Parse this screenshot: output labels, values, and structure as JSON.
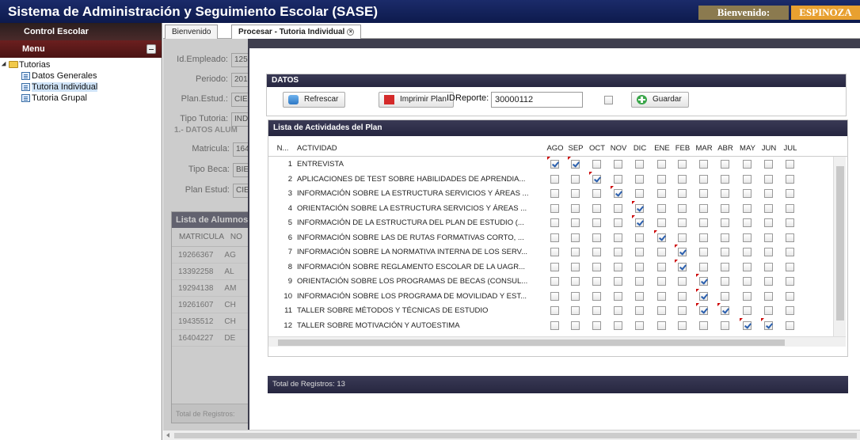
{
  "app": {
    "title": "Sistema de Administración y Seguimiento Escolar (SASE)",
    "welcome": "Bienvenido:",
    "username": "ESPINOZA"
  },
  "sidebar": {
    "header": "Control Escolar",
    "menu_label": "Menu",
    "tree": {
      "root": "Tutorias",
      "items": [
        "Datos Generales",
        "Tutoria Individual",
        "Tutoria Grupal"
      ],
      "selected": "Tutoria Individual"
    }
  },
  "tabs": [
    {
      "label": "Bienvenido",
      "active": false
    },
    {
      "label": "Procesar - Tutoria Individual",
      "active": true
    }
  ],
  "form": {
    "fields": [
      {
        "label": "Id.Empleado:",
        "value": "125"
      },
      {
        "label": "Periodo:",
        "value": "201"
      },
      {
        "label": "Plan.Estud.:",
        "value": "CIE"
      },
      {
        "label": "Tipo Tutoria:",
        "value": "IND"
      }
    ],
    "section_title": "1.- DATOS ALUM",
    "student_fields": [
      {
        "label": "Matricula:",
        "value": "164"
      },
      {
        "label": "Tipo Beca:",
        "value": "BIE"
      },
      {
        "label": "Plan Estud:",
        "value": "CIE"
      }
    ]
  },
  "alumnos": {
    "title": "Lista de Alumnos",
    "columns": [
      "MATRICULA",
      "NO"
    ],
    "rows": [
      {
        "matricula": "19266367",
        "nombre": "AG"
      },
      {
        "matricula": "13392258",
        "nombre": "AL"
      },
      {
        "matricula": "19294138",
        "nombre": "AM"
      },
      {
        "matricula": "19261607",
        "nombre": "CH"
      },
      {
        "matricula": "19435512",
        "nombre": "CH"
      },
      {
        "matricula": "16404227",
        "nombre": "DE"
      }
    ],
    "footer": "Total de Registros:"
  },
  "datos": {
    "title": "DATOS",
    "refresh_label": "Refrescar",
    "print_label": "Imprimir Plan",
    "idreporte_label": "IDReporte:",
    "idreporte_value": "30000112",
    "save_label": "Guardar"
  },
  "actividades": {
    "title": "Lista de Actividades del Plan",
    "columns": {
      "num": "N...",
      "activity": "ACTIVIDAD",
      "months": [
        "AGO",
        "SEP",
        "OCT",
        "NOV",
        "DIC",
        "ENE",
        "FEB",
        "MAR",
        "ABR",
        "MAY",
        "JUN",
        "JUL"
      ]
    },
    "rows": [
      {
        "n": "1",
        "activity": "ENTREVISTA",
        "checked": [
          0,
          1
        ]
      },
      {
        "n": "2",
        "activity": "APLICACIONES DE TEST SOBRE HABILIDADES DE APRENDIA...",
        "checked": [
          2
        ]
      },
      {
        "n": "3",
        "activity": "INFORMACIÓN SOBRE LA ESTRUCTURA SERVICIOS Y ÁREAS ...",
        "checked": [
          3
        ]
      },
      {
        "n": "4",
        "activity": "ORIENTACIÓN SOBRE LA ESTRUCTURA SERVICIOS Y ÁREAS ...",
        "checked": [
          4
        ]
      },
      {
        "n": "5",
        "activity": "INFORMACIÓN DE LA ESTRUCTURA DEL PLAN DE ESTUDIO (...",
        "checked": [
          4
        ]
      },
      {
        "n": "6",
        "activity": "INFORMACIÓN SOBRE LAS DE RUTAS FORMATIVAS CORTO, ...",
        "checked": [
          5
        ]
      },
      {
        "n": "7",
        "activity": "INFORMACIÓN SOBRE LA NORMATIVA INTERNA DE LOS SERV...",
        "checked": [
          6
        ]
      },
      {
        "n": "8",
        "activity": "INFORMACIÓN SOBRE REGLAMENTO ESCOLAR DE LA UAGR...",
        "checked": [
          6
        ]
      },
      {
        "n": "9",
        "activity": "ORIENTACIÓN SOBRE LOS PROGRAMAS DE BECAS (CONSUL...",
        "checked": [
          7
        ]
      },
      {
        "n": "10",
        "activity": "INFORMACIÓN SOBRE LOS PROGRAMA DE MOVILIDAD Y EST...",
        "checked": [
          7
        ]
      },
      {
        "n": "11",
        "activity": "TALLER SOBRE MÉTODOS Y TÉCNICAS DE ESTUDIO",
        "checked": [
          7,
          8
        ]
      },
      {
        "n": "12",
        "activity": "TALLER SOBRE MOTIVACIÓN Y AUTOESTIMA",
        "checked": [
          9,
          10
        ]
      }
    ],
    "footer": "Total de Registros: 13"
  }
}
